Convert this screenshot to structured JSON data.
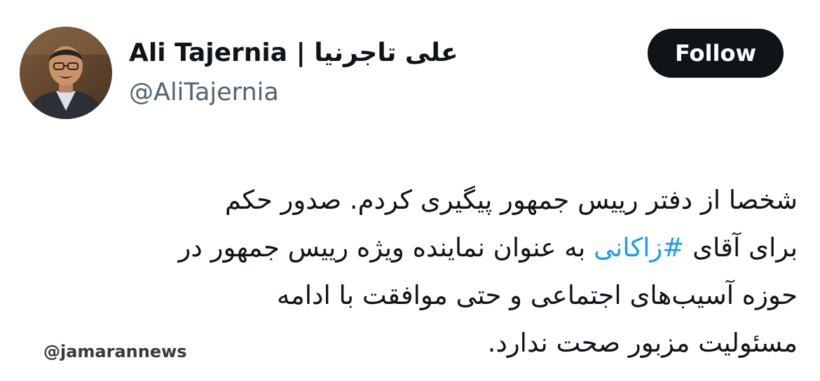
{
  "author": {
    "display_name": "Ali Tajernia | علی تاجرنیا",
    "handle": "@AliTajernia",
    "avatar": "profile-photo"
  },
  "follow_label": "Follow",
  "tweet": {
    "line1": "شخصا از دفتر رییس جمهور پیگیری کردم. صدور حکم",
    "line2_before": "برای آقای ",
    "hashtag": "#زاکانی",
    "line2_after": " به عنوان نماینده ویژه رییس جمهور در",
    "line3": "حوزه آسیب‌های اجتماعی و حتی موافقت با ادامه",
    "line4": "مسئولیت مزبور صحت ندارد."
  },
  "watermark": "@jamarannews",
  "colors": {
    "text": "#0f1419",
    "secondary": "#536471",
    "link": "#1d9bf0",
    "button_bg": "#0f1419",
    "button_text": "#ffffff"
  }
}
